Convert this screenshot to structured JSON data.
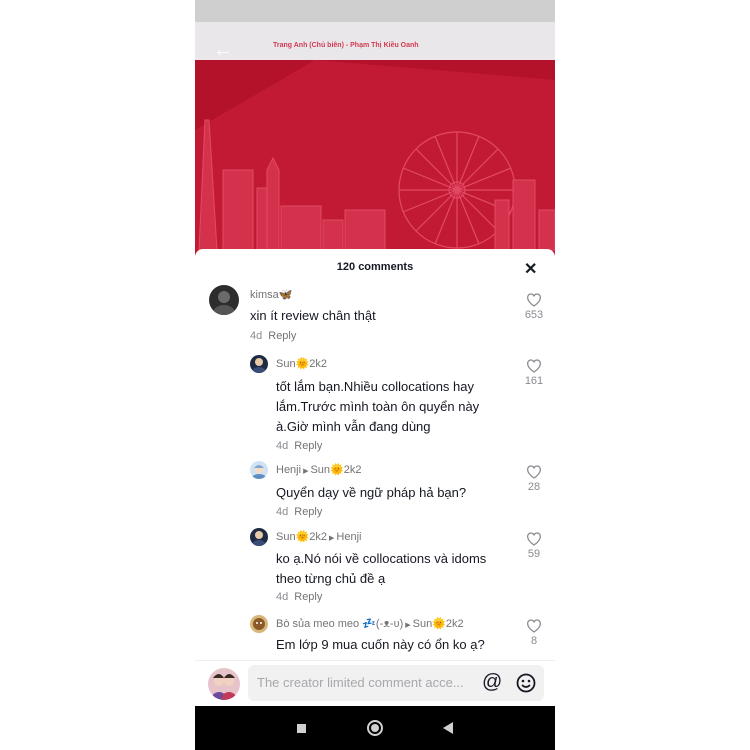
{
  "video": {
    "cover_author": "Trang Anh (Chủ biên) - Phạm Thị Kiều Oanh",
    "accent_color": "#b4122a"
  },
  "comments_sheet": {
    "title": "120 comments",
    "close_icon": "close-icon"
  },
  "comments": [
    {
      "username": "kimsa🦋",
      "reply_to": "",
      "text": "xin ít review chân thật",
      "time": "4d",
      "reply_label": "Reply",
      "likes": "653"
    },
    {
      "username": "Sun🌞2k2",
      "reply_to": "",
      "text": "tốt lắm bạn.Nhiều collocations hay lắm.Trước mình toàn ôn quyển này à.Giờ mình vẫn đang dùng",
      "time": "4d",
      "reply_label": "Reply",
      "likes": "161"
    },
    {
      "username": "Henji",
      "reply_to": "Sun🌞2k2",
      "text": "Quyển dạy về ngữ pháp hả bạn?",
      "time": "4d",
      "reply_label": "Reply",
      "likes": "28"
    },
    {
      "username": "Sun🌞2k2",
      "reply_to": "Henji",
      "text": "ko ạ.Nó nói về collocations và idoms theo từng chủ đề ạ",
      "time": "4d",
      "reply_label": "Reply",
      "likes": "59"
    },
    {
      "username": "Bò sủa meo meo 💤(-ᴥ-ʋ)",
      "reply_to": "Sun🌞2k2",
      "text": "Em lớp 9 mua cuốn này có ổn ko ạ?",
      "time": "",
      "reply_label": "",
      "likes": "8"
    }
  ],
  "input_bar": {
    "placeholder": "The creator limited comment acce...",
    "mention_icon": "at-icon",
    "emoji_icon": "emoji-icon"
  },
  "system_nav": {
    "icons": [
      "recent-apps-icon",
      "home-icon",
      "back-icon"
    ]
  }
}
